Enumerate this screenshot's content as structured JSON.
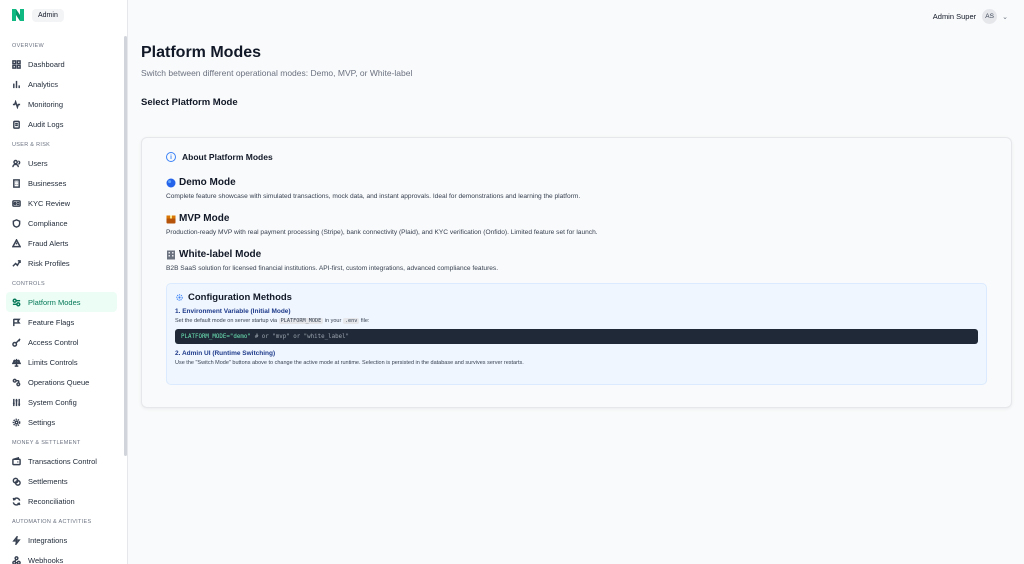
{
  "brand": {
    "label": "Admin",
    "color": "#10b981"
  },
  "user": {
    "name": "Admin Super",
    "initials": "AS"
  },
  "sidebar": {
    "sections": [
      {
        "label": "OVERVIEW",
        "items": [
          {
            "label": "Dashboard",
            "icon": "grid-icon"
          },
          {
            "label": "Analytics",
            "icon": "bar-chart-icon"
          },
          {
            "label": "Monitoring",
            "icon": "activity-icon"
          },
          {
            "label": "Audit Logs",
            "icon": "clipboard-icon"
          }
        ]
      },
      {
        "label": "USER & RISK",
        "items": [
          {
            "label": "Users",
            "icon": "users-icon"
          },
          {
            "label": "Businesses",
            "icon": "building-icon"
          },
          {
            "label": "KYC Review",
            "icon": "id-card-icon"
          },
          {
            "label": "Compliance",
            "icon": "shield-icon"
          },
          {
            "label": "Fraud Alerts",
            "icon": "alert-triangle-icon"
          },
          {
            "label": "Risk Profiles",
            "icon": "trending-up-icon"
          }
        ]
      },
      {
        "label": "CONTROLS",
        "items": [
          {
            "label": "Platform Modes",
            "icon": "toggle-icon",
            "active": true
          },
          {
            "label": "Feature Flags",
            "icon": "flag-icon"
          },
          {
            "label": "Access Control",
            "icon": "key-icon"
          },
          {
            "label": "Limits Controls",
            "icon": "scale-icon"
          },
          {
            "label": "Operations Queue",
            "icon": "queue-icon"
          },
          {
            "label": "System Config",
            "icon": "sliders-icon"
          },
          {
            "label": "Settings",
            "icon": "gear-icon"
          }
        ]
      },
      {
        "label": "MONEY & SETTLEMENT",
        "items": [
          {
            "label": "Transactions Control",
            "icon": "wallet-icon"
          },
          {
            "label": "Settlements",
            "icon": "coins-icon"
          },
          {
            "label": "Reconciliation",
            "icon": "refresh-icon"
          }
        ]
      },
      {
        "label": "AUTOMATION & ACTIVITIES",
        "items": [
          {
            "label": "Integrations",
            "icon": "zap-icon"
          },
          {
            "label": "Webhooks",
            "icon": "webhook-icon"
          }
        ]
      }
    ]
  },
  "main": {
    "title": "Platform Modes",
    "subtitle": "Switch between different operational modes: Demo, MVP, or White-label",
    "section_title": "Select Platform Mode",
    "about": {
      "heading": "About Platform Modes",
      "modes": [
        {
          "title": "Demo Mode",
          "icon": "blue-circle-icon",
          "desc": "Complete feature showcase with simulated transactions, mock data, and instant approvals. Ideal for demonstrations and learning the platform."
        },
        {
          "title": "MVP Mode",
          "icon": "package-icon",
          "desc": "Production-ready MVP with real payment processing (Stripe), bank connectivity (Plaid), and KYC verification (Onfido). Limited feature set for launch."
        },
        {
          "title": "White-label Mode",
          "icon": "office-building-icon",
          "desc": "B2B SaaS solution for licensed financial institutions. API-first, custom integrations, advanced compliance features."
        }
      ]
    },
    "config": {
      "title": "Configuration Methods",
      "env_heading": "1. Environment Variable (Initial Mode)",
      "env_text_pre": "Set the default mode on server startup via",
      "env_var": "PLATFORM_MODE",
      "env_text_mid": "in your",
      "env_file": ".env",
      "env_text_post": "file:",
      "code_value": "PLATFORM_MODE=\"demo\"",
      "code_comment": "# or \"mvp\" or \"white_label\"",
      "ui_heading": "2. Admin UI (Runtime Switching)",
      "ui_text": "Use the \"Switch Mode\" buttons above to change the active mode at runtime. Selection is persisted in the database and survives server restarts."
    }
  }
}
